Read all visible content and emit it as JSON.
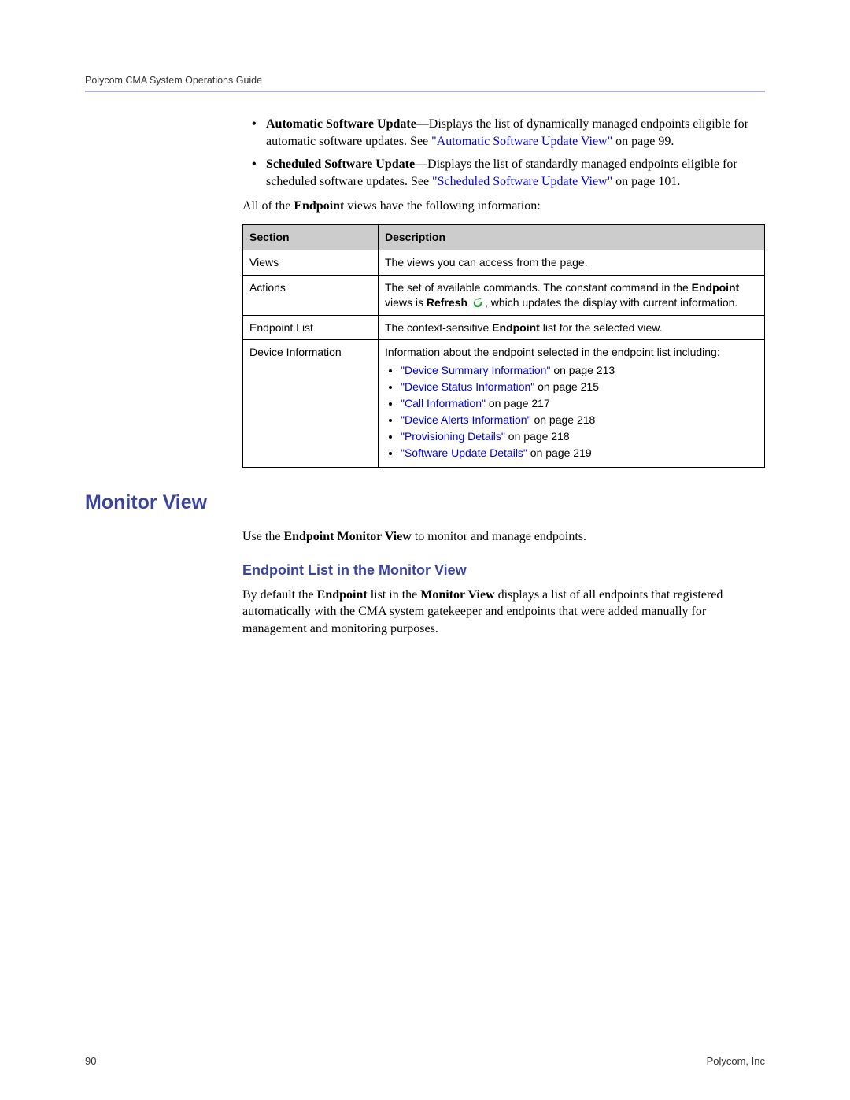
{
  "header": {
    "running": "Polycom CMA System Operations Guide"
  },
  "bullets": [
    {
      "label": "Automatic Software Update",
      "dash": "—",
      "text1": "Displays the list of dynamically managed endpoints eligible for automatic software updates. See ",
      "link": "\"Automatic Software Update View\"",
      "text2": " on page 99."
    },
    {
      "label": "Scheduled Software Update",
      "dash": "—",
      "text1": "Displays the list of standardly managed endpoints eligible for scheduled software updates. See ",
      "link": "\"Scheduled Software Update View\"",
      "text2": " on page 101."
    }
  ],
  "para_all_views_pre": "All of the ",
  "para_all_views_bold": "Endpoint",
  "para_all_views_post": " views have the following information:",
  "table": {
    "head": {
      "c1": "Section",
      "c2": "Description"
    },
    "rows": {
      "views": {
        "c1": "Views",
        "c2": "The views you can access from the page."
      },
      "actions": {
        "c1": "Actions",
        "t1": "The set of available commands. The constant command in the ",
        "b1": "Endpoint",
        "t2": " views is ",
        "b2": "Refresh",
        "t3": ", which updates the display with current information."
      },
      "endpoint_list": {
        "c1": "Endpoint List",
        "t1": "The context-sensitive ",
        "b1": "Endpoint",
        "t2": " list for the selected view."
      },
      "device_info": {
        "c1": "Device Information",
        "t1": "Information about the endpoint selected in the endpoint list including:",
        "items": [
          {
            "link": "\"Device Summary Information\"",
            "tail": " on page 213"
          },
          {
            "link": "\"Device Status Information\"",
            "tail": " on page 215"
          },
          {
            "link": "\"Call Information\"",
            "tail": " on page 217"
          },
          {
            "link": "\"Device Alerts Information\"",
            "tail": " on page 218"
          },
          {
            "link": "\"Provisioning Details\"",
            "tail": " on page 218"
          },
          {
            "link": "\"Software Update Details\"",
            "tail": " on page 219"
          }
        ]
      }
    }
  },
  "h1": "Monitor View",
  "monitor_intro_pre": "Use the ",
  "monitor_intro_bold": "Endpoint Monitor View",
  "monitor_intro_post": " to monitor and manage endpoints.",
  "h2": "Endpoint List in the Monitor View",
  "monitor_body": {
    "t1": "By default the ",
    "b1": "Endpoint",
    "t2": " list in the ",
    "b2": "Monitor View",
    "t3": " displays a list of all endpoints that registered automatically with the CMA system gatekeeper and endpoints that were added manually for management and monitoring purposes."
  },
  "footer": {
    "page": "90",
    "company": "Polycom, Inc"
  }
}
